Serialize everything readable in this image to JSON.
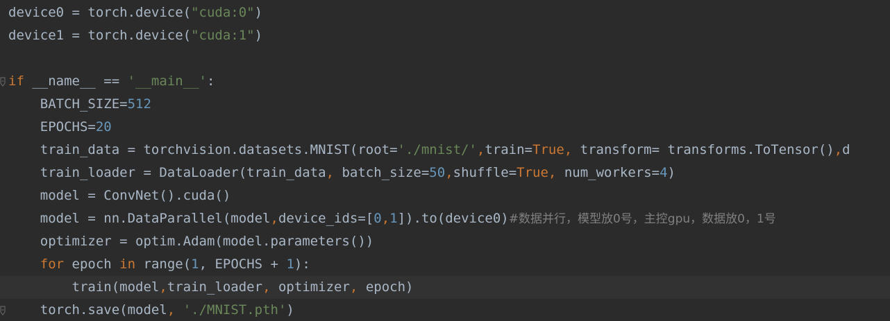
{
  "editor": {
    "lines": [
      {
        "tokens": [
          {
            "t": "device0 = torch.device(",
            "c": "id"
          },
          {
            "t": "\"cuda:0\"",
            "c": "str"
          },
          {
            "t": ")",
            "c": "id"
          }
        ]
      },
      {
        "tokens": [
          {
            "t": "device1 = torch.device(",
            "c": "id"
          },
          {
            "t": "\"cuda:1\"",
            "c": "str"
          },
          {
            "t": ")",
            "c": "id"
          }
        ]
      },
      {
        "tokens": []
      },
      {
        "tokens": [
          {
            "t": "if",
            "c": "kw"
          },
          {
            "t": " __name__ == ",
            "c": "id"
          },
          {
            "t": "'__main__'",
            "c": "str"
          },
          {
            "t": ":",
            "c": "id"
          }
        ]
      },
      {
        "tokens": [
          {
            "t": "    BATCH_SIZE=",
            "c": "id"
          },
          {
            "t": "512",
            "c": "num"
          }
        ]
      },
      {
        "tokens": [
          {
            "t": "    EPOCHS=",
            "c": "id"
          },
          {
            "t": "20",
            "c": "num"
          }
        ]
      },
      {
        "tokens": [
          {
            "t": "    train_data = torchvision.datasets.MNIST(root=",
            "c": "id"
          },
          {
            "t": "'./mnist/'",
            "c": "str"
          },
          {
            "t": ",",
            "c": "kw"
          },
          {
            "t": "train=",
            "c": "id"
          },
          {
            "t": "True",
            "c": "kw"
          },
          {
            "t": ",",
            "c": "kw"
          },
          {
            "t": " transform= transforms.ToTensor()",
            "c": "id"
          },
          {
            "t": ",",
            "c": "kw"
          },
          {
            "t": "d",
            "c": "id"
          }
        ]
      },
      {
        "tokens": [
          {
            "t": "    train_loader = DataLoader(train_data",
            "c": "id"
          },
          {
            "t": ",",
            "c": "kw"
          },
          {
            "t": " batch_size=",
            "c": "id"
          },
          {
            "t": "50",
            "c": "num"
          },
          {
            "t": ",",
            "c": "kw"
          },
          {
            "t": "shuffle=",
            "c": "id"
          },
          {
            "t": "True",
            "c": "kw"
          },
          {
            "t": ",",
            "c": "kw"
          },
          {
            "t": " num_workers=",
            "c": "id"
          },
          {
            "t": "4",
            "c": "num"
          },
          {
            "t": ")",
            "c": "id"
          }
        ]
      },
      {
        "tokens": [
          {
            "t": "    model = ConvNet().cuda()",
            "c": "id"
          }
        ]
      },
      {
        "tokens": [
          {
            "t": "    model = nn.DataParallel(model",
            "c": "id"
          },
          {
            "t": ",",
            "c": "kw"
          },
          {
            "t": "device_ids=[",
            "c": "id"
          },
          {
            "t": "0",
            "c": "num"
          },
          {
            "t": ",",
            "c": "kw"
          },
          {
            "t": "1",
            "c": "num"
          },
          {
            "t": "]).to(device0)",
            "c": "id"
          },
          {
            "t": "#数据并行，模型放0号，主控gpu，数据放0，1号",
            "c": "cmt"
          }
        ]
      },
      {
        "tokens": [
          {
            "t": "    optimizer = optim.Adam(model.parameters())",
            "c": "id"
          }
        ]
      },
      {
        "tokens": [
          {
            "t": "    ",
            "c": "id"
          },
          {
            "t": "for",
            "c": "kw"
          },
          {
            "t": " epoch ",
            "c": "id"
          },
          {
            "t": "in",
            "c": "kw"
          },
          {
            "t": " range(",
            "c": "id"
          },
          {
            "t": "1",
            "c": "num"
          },
          {
            "t": ", EPOCHS + ",
            "c": "id"
          },
          {
            "t": "1",
            "c": "num"
          },
          {
            "t": "):",
            "c": "id"
          }
        ]
      },
      {
        "tokens": [
          {
            "t": "        train(model",
            "c": "id"
          },
          {
            "t": ",",
            "c": "kw"
          },
          {
            "t": "train_loader",
            "c": "id"
          },
          {
            "t": ",",
            "c": "kw"
          },
          {
            "t": " optimizer",
            "c": "id"
          },
          {
            "t": ",",
            "c": "kw"
          },
          {
            "t": " epoch)",
            "c": "id"
          }
        ]
      },
      {
        "tokens": [
          {
            "t": "    torch.save(model",
            "c": "id"
          },
          {
            "t": ",",
            "c": "kw"
          },
          {
            "t": " ",
            "c": "id"
          },
          {
            "t": "'./MNIST.pth'",
            "c": "str"
          },
          {
            "t": ")",
            "c": "id"
          }
        ]
      }
    ],
    "current_line": 12,
    "fold_markers": [
      3,
      13
    ],
    "colors": {
      "background": "#2b2b2b",
      "current_line": "#323232",
      "identifier": "#a9b7c6",
      "keyword": "#cc7832",
      "number": "#6897bb",
      "string": "#6a8759",
      "comment": "#808080"
    }
  }
}
